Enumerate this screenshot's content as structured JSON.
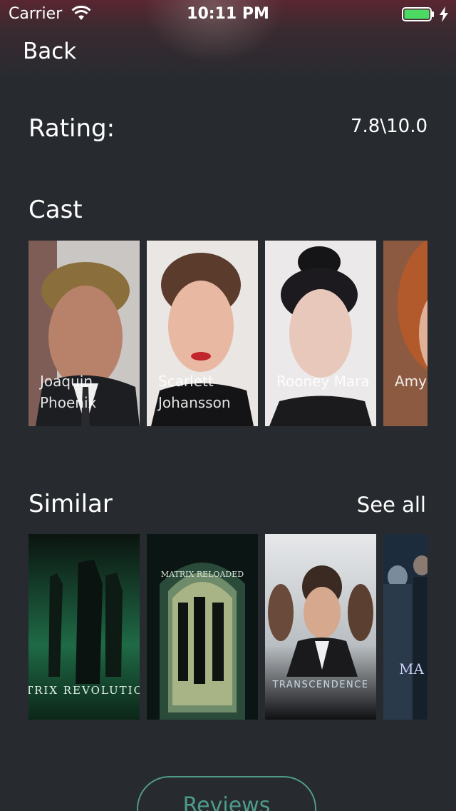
{
  "status_bar": {
    "carrier": "Carrier",
    "time": "10:11 PM",
    "battery_color": "#4cd964"
  },
  "nav": {
    "back_label": "Back"
  },
  "rating": {
    "label": "Rating:",
    "value": "7.8\\10.0"
  },
  "cast": {
    "title": "Cast",
    "members": [
      {
        "name": "Joaquin Phoenix"
      },
      {
        "name": "Scarlett Johansson"
      },
      {
        "name": "Rooney Mara"
      },
      {
        "name": "Amy"
      }
    ]
  },
  "similar": {
    "title": "Similar",
    "see_all_label": "See all",
    "movies": [
      {
        "poster_text": "MATRIX REVOLUTIONS"
      },
      {
        "poster_text": "MATRIX RELOADED"
      },
      {
        "poster_text": "TRANSCENDENCE"
      },
      {
        "poster_text": "MA"
      }
    ]
  },
  "actions": {
    "reviews_label": "Reviews"
  },
  "colors": {
    "background": "#272b30",
    "accent": "#4e9b8a"
  }
}
